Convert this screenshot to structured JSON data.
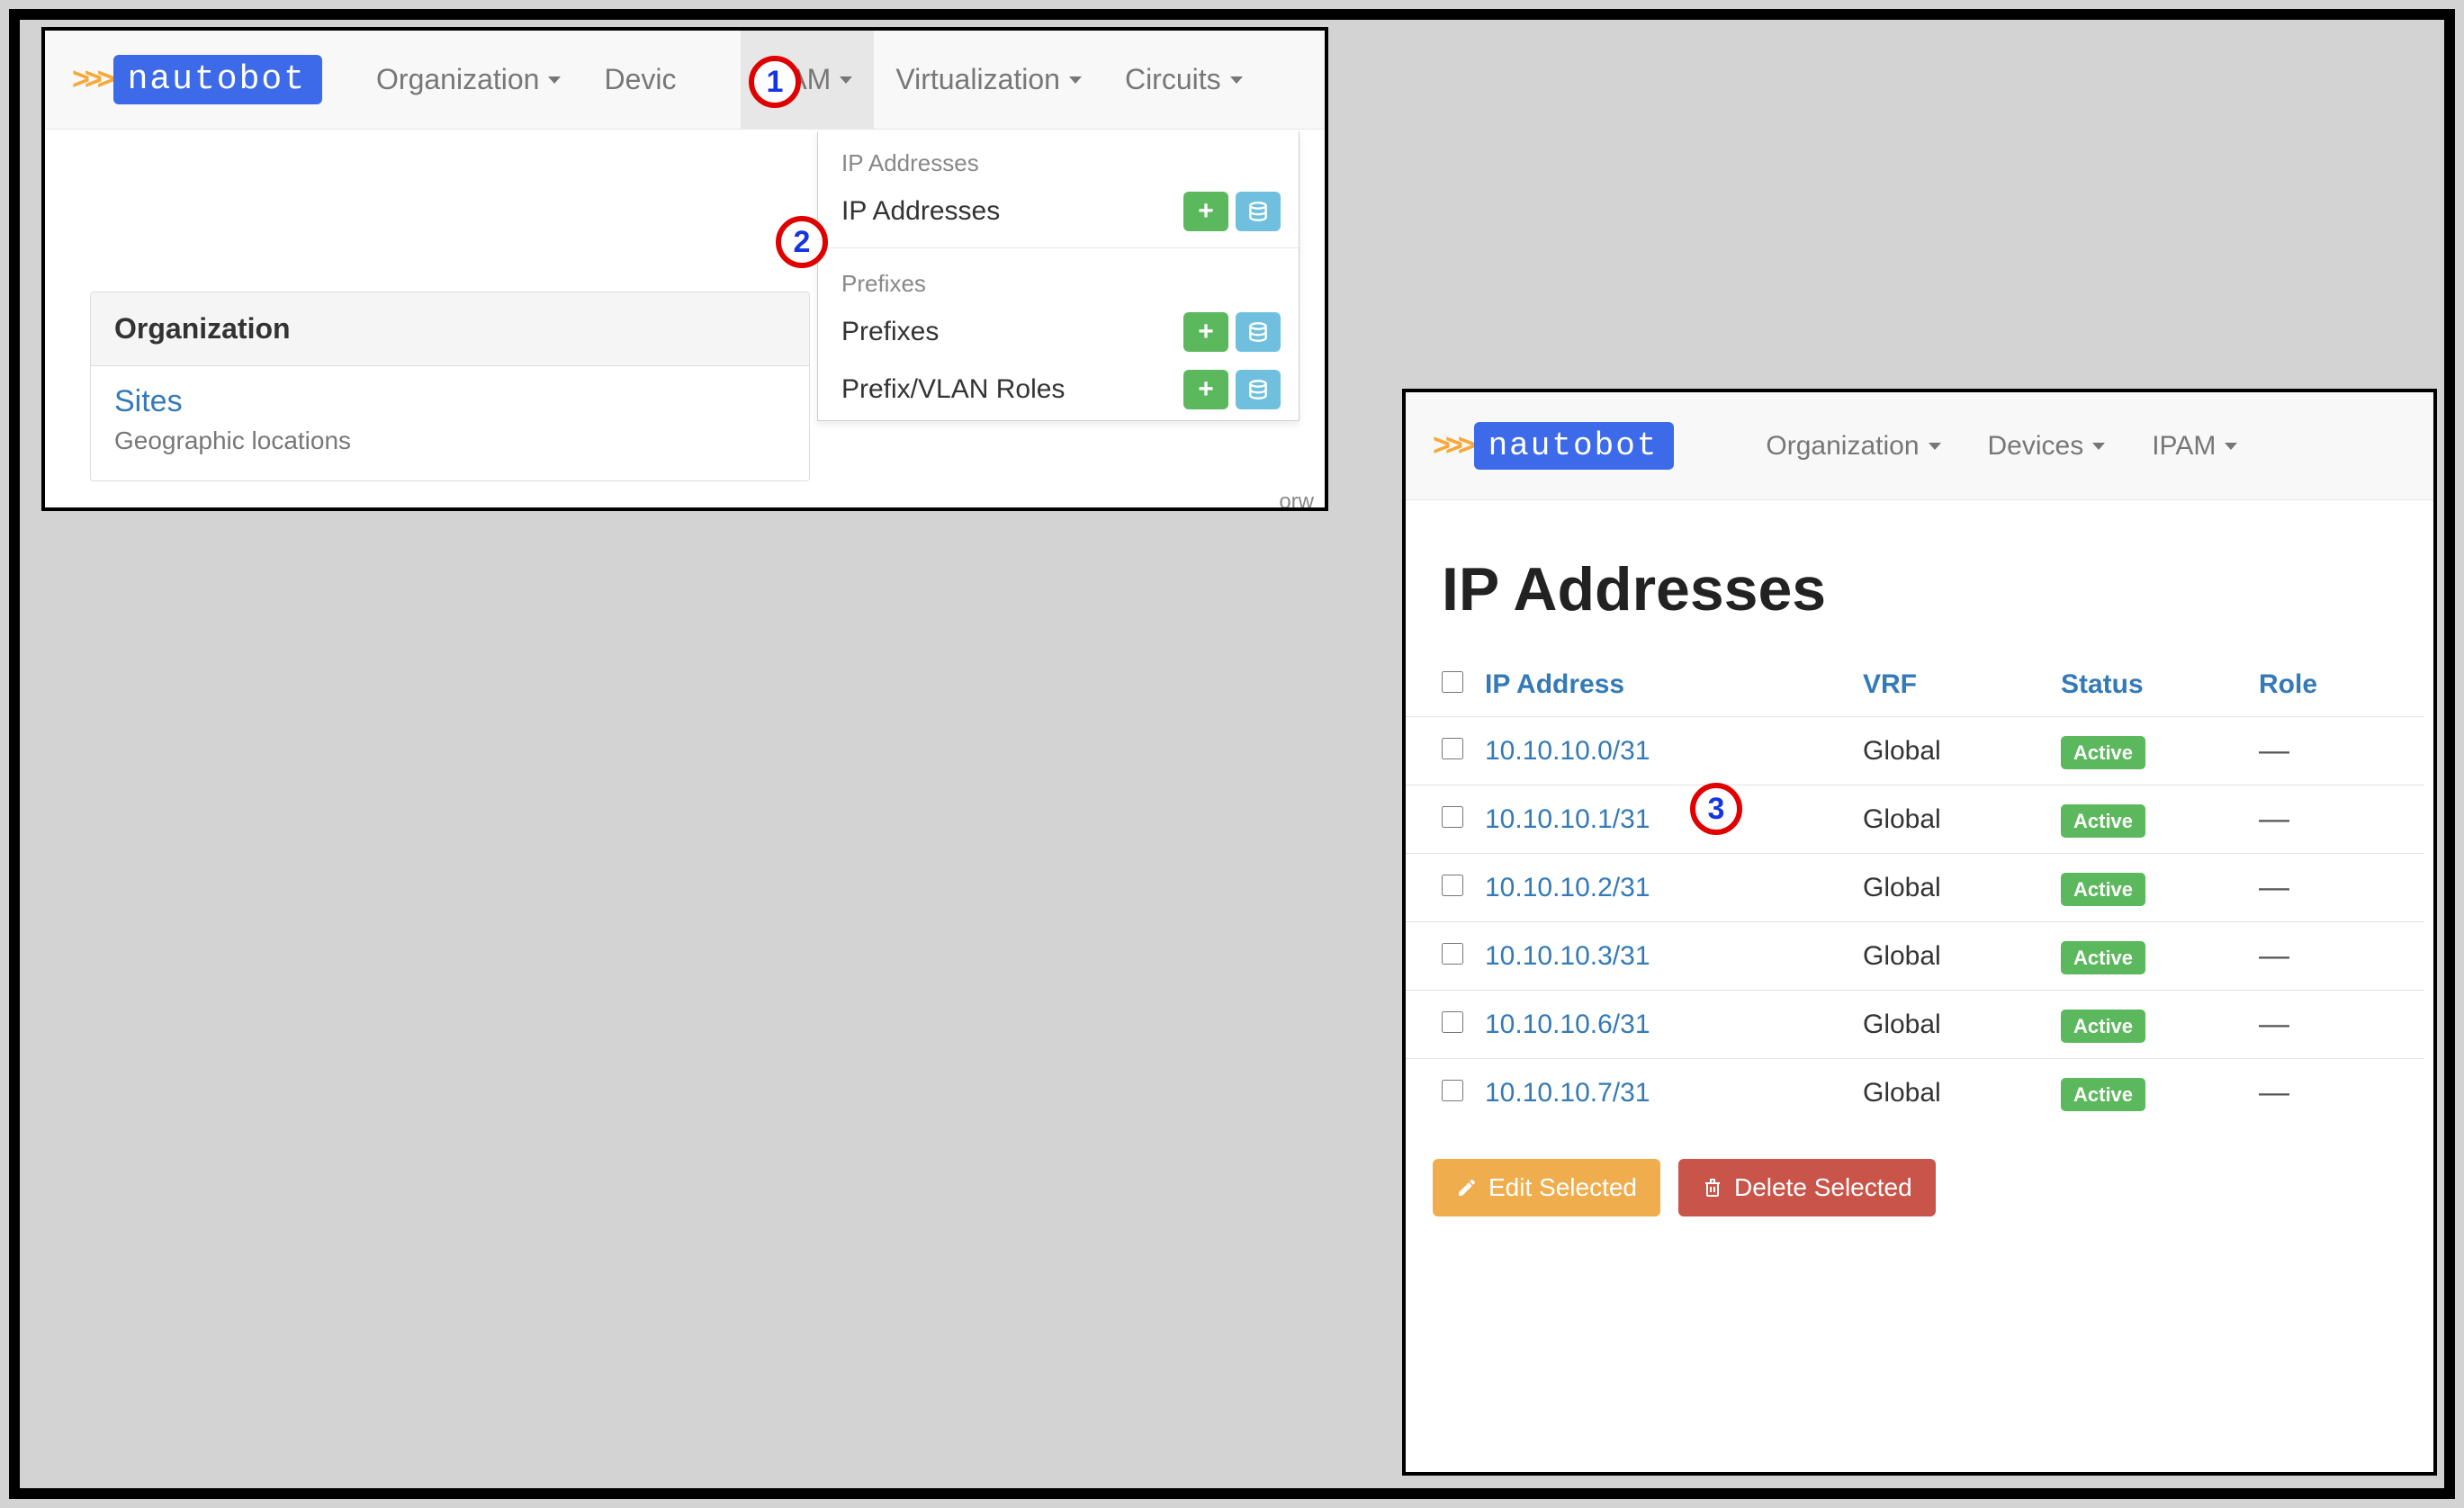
{
  "brand": {
    "name": "nautobot"
  },
  "panel1": {
    "nav": {
      "organization": "Organization",
      "devices": "Devic",
      "ipam": "IPAM",
      "virtualization": "Virtualization",
      "circuits": "Circuits"
    },
    "dropdown": {
      "section1_header": "IP Addresses",
      "item_ip_addresses": "IP Addresses",
      "section2_header": "Prefixes",
      "item_prefixes": "Prefixes",
      "item_prefix_roles": "Prefix/VLAN Roles"
    },
    "org_card": {
      "header": "Organization",
      "sites_title": "Sites",
      "sites_subtitle": "Geographic locations"
    },
    "truncated": "orw"
  },
  "panel2": {
    "nav": {
      "organization": "Organization",
      "devices": "Devices",
      "ipam": "IPAM"
    },
    "page_title": "IP Addresses",
    "table": {
      "columns": {
        "ip": "IP Address",
        "vrf": "VRF",
        "status": "Status",
        "role": "Role"
      },
      "rows": [
        {
          "ip": "10.10.10.0/31",
          "vrf": "Global",
          "status": "Active",
          "role": "—"
        },
        {
          "ip": "10.10.10.1/31",
          "vrf": "Global",
          "status": "Active",
          "role": "—"
        },
        {
          "ip": "10.10.10.2/31",
          "vrf": "Global",
          "status": "Active",
          "role": "—"
        },
        {
          "ip": "10.10.10.3/31",
          "vrf": "Global",
          "status": "Active",
          "role": "—"
        },
        {
          "ip": "10.10.10.6/31",
          "vrf": "Global",
          "status": "Active",
          "role": "—"
        },
        {
          "ip": "10.10.10.7/31",
          "vrf": "Global",
          "status": "Active",
          "role": "—"
        }
      ]
    },
    "actions": {
      "edit": "Edit Selected",
      "delete": "Delete Selected"
    }
  },
  "callouts": {
    "c1": "1",
    "c2": "2",
    "c3": "3"
  }
}
